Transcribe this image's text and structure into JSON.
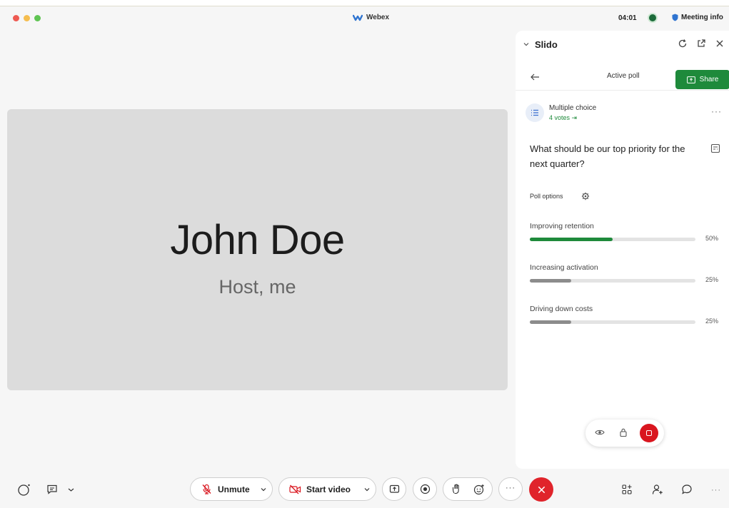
{
  "titlebar": {
    "app_name": "Webex",
    "clock": "04:01",
    "meeting_info": "Meeting info"
  },
  "stage": {
    "participant_name": "John Doe",
    "participant_role": "Host, me"
  },
  "slido": {
    "title": "Slido",
    "subheader": "Active poll",
    "share_label": "Share",
    "poll_type": "Multiple choice",
    "votes": "4 votes",
    "question": "What should be our top priority for the next quarter?",
    "options_label": "Poll options",
    "options": [
      {
        "label": "Improving retention",
        "percent": "50%",
        "value": 50
      },
      {
        "label": "Increasing activation",
        "percent": "25%",
        "value": 25
      },
      {
        "label": "Driving down costs",
        "percent": "25%",
        "value": 25
      }
    ],
    "colors": {
      "winner": "#1e8a3b",
      "other": "#8c8c8c",
      "accent": "#1e8a3b",
      "stop": "#d9161f"
    }
  },
  "controls": {
    "unmute_label": "Unmute",
    "start_video_label": "Start video"
  },
  "icons": [
    "webex-logo",
    "shield-icon",
    "refresh-icon",
    "popout-icon",
    "close-icon",
    "back-arrow-icon",
    "list-icon",
    "gear-icon",
    "eye-icon",
    "lock-icon",
    "stop-icon",
    "mic-muted-icon",
    "video-off-icon",
    "share-screen-icon",
    "record-icon",
    "raise-hand-icon",
    "reactions-icon",
    "more-icon",
    "end-call-icon",
    "apps-icon",
    "participants-icon",
    "chat-icon"
  ]
}
